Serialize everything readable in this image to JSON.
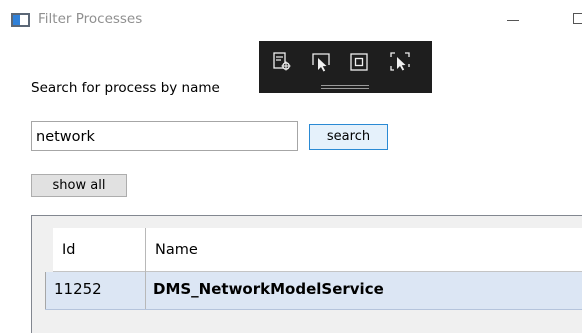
{
  "window": {
    "title": "Filter Processes"
  },
  "toolbar": {
    "buttons": [
      {
        "icon": "live-visual-tree-icon"
      },
      {
        "icon": "select-element-icon"
      },
      {
        "icon": "display-layout-adorners-icon"
      },
      {
        "icon": "track-focused-element-icon"
      }
    ]
  },
  "search": {
    "label": "Search for process by name",
    "value": "network",
    "button_label": "search"
  },
  "show_all_label": "show all",
  "grid": {
    "columns": [
      "Id",
      "Name"
    ],
    "rows": [
      {
        "id": "11252",
        "name": "DMS_NetworkModelService"
      }
    ]
  },
  "colors": {
    "selected_row": "#dce6f4",
    "toolbar_bg": "#1e1e1e",
    "search_button_border": "#2a8ad4",
    "app_icon_accent": "#2f80d8"
  }
}
